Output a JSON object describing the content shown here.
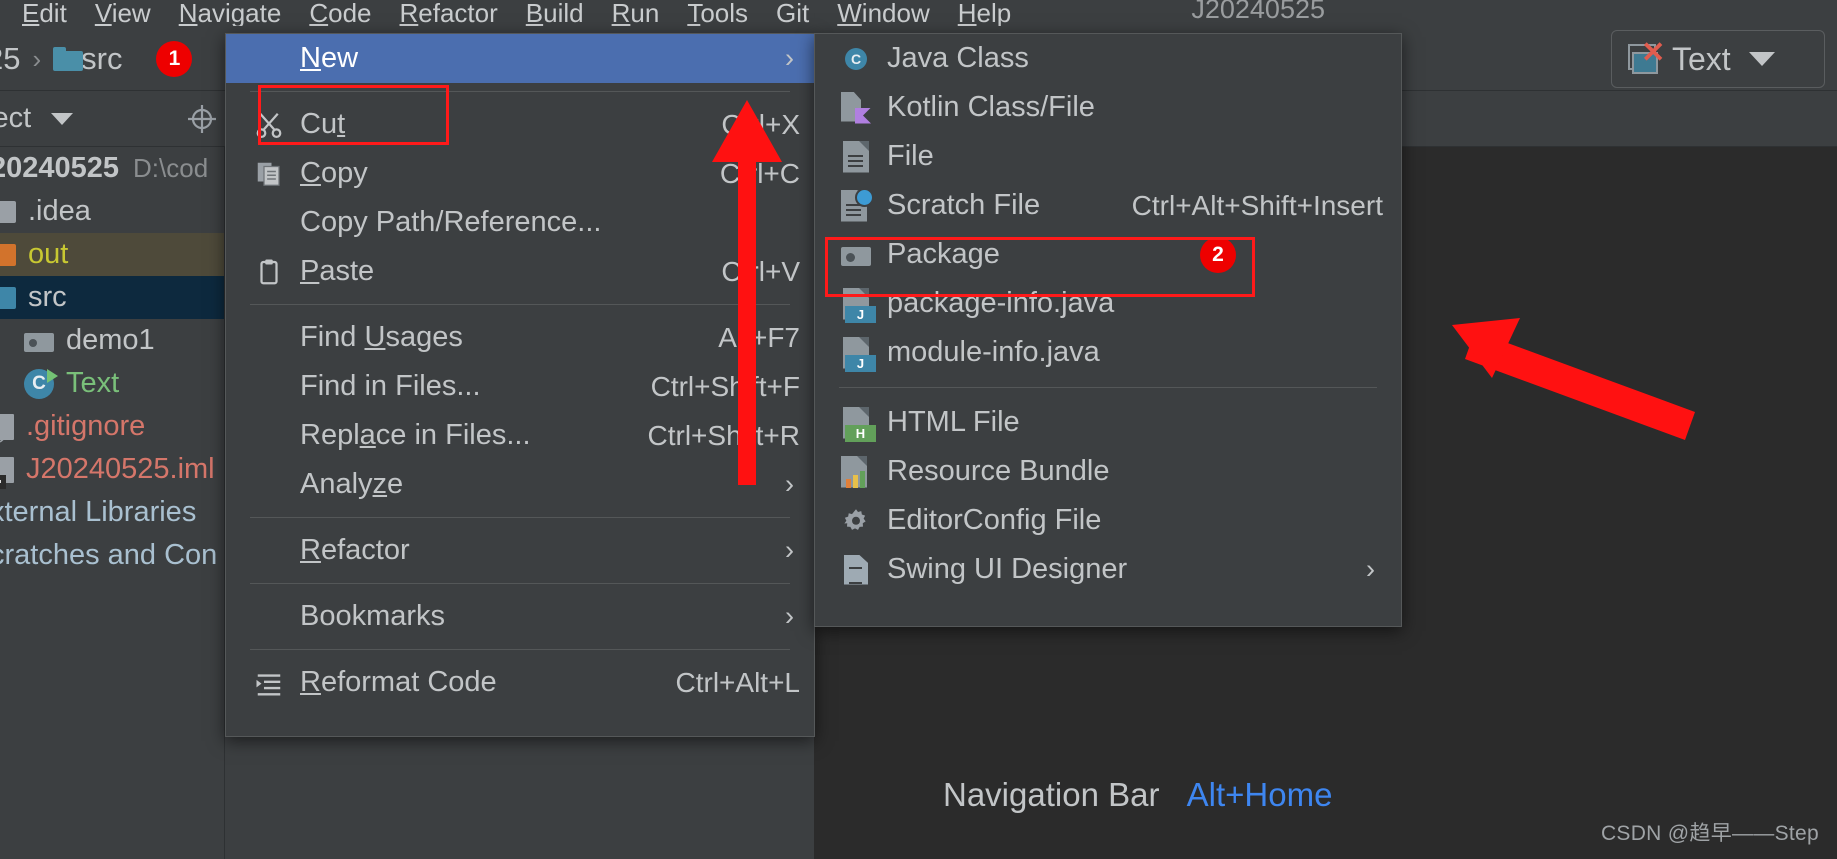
{
  "menubar": {
    "items": [
      "Edit",
      "View",
      "Navigate",
      "Code",
      "Refactor",
      "Build",
      "Run",
      "Tools",
      "Git",
      "Window",
      "Help"
    ],
    "project_title": "J20240525"
  },
  "breadcrumb": {
    "prefix": "25",
    "separator": "›",
    "folder_label": "src",
    "badge": "1"
  },
  "toolwindow": {
    "label": "ject",
    "locate_icon": "locate-icon"
  },
  "tree": {
    "rows": [
      {
        "name": "20240525",
        "path": "D:\\cod",
        "kind": "project",
        "color": ""
      },
      {
        "name": ".idea",
        "path": "",
        "kind": "square-gray",
        "color": ""
      },
      {
        "name": "out",
        "path": "",
        "kind": "square-orange",
        "color": "yellow"
      },
      {
        "name": "src",
        "path": "",
        "kind": "square-blue",
        "color": ""
      },
      {
        "name": "demo1",
        "path": "",
        "kind": "folder",
        "color": ""
      },
      {
        "name": "Text",
        "path": "",
        "kind": "java-class",
        "color": "green"
      },
      {
        "name": ".gitignore",
        "path": "",
        "kind": "file-ignored",
        "color": "red"
      },
      {
        "name": "J20240525.iml",
        "path": "",
        "kind": "file-iml",
        "color": "red"
      },
      {
        "name": "xternal Libraries",
        "path": "",
        "kind": "none",
        "color": "blue"
      },
      {
        "name": "cratches and Con",
        "path": "",
        "kind": "none",
        "color": "blue"
      }
    ]
  },
  "context_menu": {
    "items": [
      {
        "label": "New",
        "label_mnemonic": "N",
        "shortcut": "",
        "arrow": "›",
        "icon": "",
        "highlighted": true
      },
      {
        "sep": true
      },
      {
        "label": "Cut",
        "label_mnemonic": "t",
        "shortcut": "Ctrl+X",
        "arrow": "",
        "icon": "scissors-icon"
      },
      {
        "label": "Copy",
        "label_mnemonic": "C",
        "shortcut": "Ctrl+C",
        "arrow": "",
        "icon": "copy-icon"
      },
      {
        "label": "Copy Path/Reference...",
        "shortcut": "",
        "arrow": "",
        "icon": ""
      },
      {
        "label": "Paste",
        "label_mnemonic": "P",
        "shortcut": "Ctrl+V",
        "arrow": "",
        "icon": "clipboard-icon"
      },
      {
        "sep": true
      },
      {
        "label": "Find Usages",
        "label_mnemonic": "U",
        "shortcut": "Alt+F7",
        "arrow": "",
        "icon": ""
      },
      {
        "label": "Find in Files...",
        "shortcut": "Ctrl+Shift+F",
        "arrow": "",
        "icon": ""
      },
      {
        "label": "Replace in Files...",
        "label_mnemonic": "a",
        "shortcut": "Ctrl+Shift+R",
        "arrow": "",
        "icon": ""
      },
      {
        "label": "Analyze",
        "label_mnemonic": "z",
        "shortcut": "",
        "arrow": "›",
        "icon": ""
      },
      {
        "sep": true
      },
      {
        "label": "Refactor",
        "label_mnemonic": "R",
        "shortcut": "",
        "arrow": "›",
        "icon": ""
      },
      {
        "sep": true
      },
      {
        "label": "Bookmarks",
        "shortcut": "",
        "arrow": "›",
        "icon": ""
      },
      {
        "sep": true
      },
      {
        "label": "Reformat Code",
        "label_mnemonic": "R",
        "shortcut": "Ctrl+Alt+L",
        "arrow": "",
        "icon": "reformat-icon"
      }
    ],
    "highlight_box_target": "New"
  },
  "submenu": {
    "items": [
      {
        "label": "Java Class",
        "shortcut": "",
        "arrow": "",
        "icon": "java-class-icon"
      },
      {
        "label": "Kotlin Class/File",
        "shortcut": "",
        "arrow": "",
        "icon": "kotlin-file-icon"
      },
      {
        "label": "File",
        "shortcut": "",
        "arrow": "",
        "icon": "file-icon"
      },
      {
        "label": "Scratch File",
        "shortcut": "Ctrl+Alt+Shift+Insert",
        "arrow": "",
        "icon": "scratch-file-icon"
      },
      {
        "label": "Package",
        "shortcut": "",
        "arrow": "",
        "icon": "package-folder-icon",
        "badge": "2"
      },
      {
        "label": "package-info.java",
        "shortcut": "",
        "arrow": "",
        "icon": "java-file-icon"
      },
      {
        "label": "module-info.java",
        "shortcut": "",
        "arrow": "",
        "icon": "java-file-icon"
      },
      {
        "sep": true
      },
      {
        "label": "HTML File",
        "shortcut": "",
        "arrow": "",
        "icon": "html-file-icon"
      },
      {
        "label": "Resource Bundle",
        "shortcut": "",
        "arrow": "",
        "icon": "resource-bundle-icon"
      },
      {
        "label": "EditorConfig File",
        "shortcut": "",
        "arrow": "",
        "icon": "gear-icon"
      },
      {
        "label": "Swing UI Designer",
        "shortcut": "",
        "arrow": "›",
        "icon": "swing-form-icon"
      }
    ],
    "highlight_box_target": "Package"
  },
  "navbar_hint": {
    "label": "Navigation Bar",
    "shortcut": "Alt+Home"
  },
  "text_dropdown": {
    "label": "Text",
    "icon": "window-close-icon",
    "chevron": "chevron-down-icon"
  },
  "watermark": "CSDN @趋早——Step",
  "colors": {
    "accent_highlight": "#4b6eaf",
    "annotation_red": "#ff1a1a",
    "badge_red": "#ee0000",
    "shortcut_blue": "#3e86f0",
    "bg": "#3c3f41",
    "editor_bg": "#2b2b2b"
  }
}
